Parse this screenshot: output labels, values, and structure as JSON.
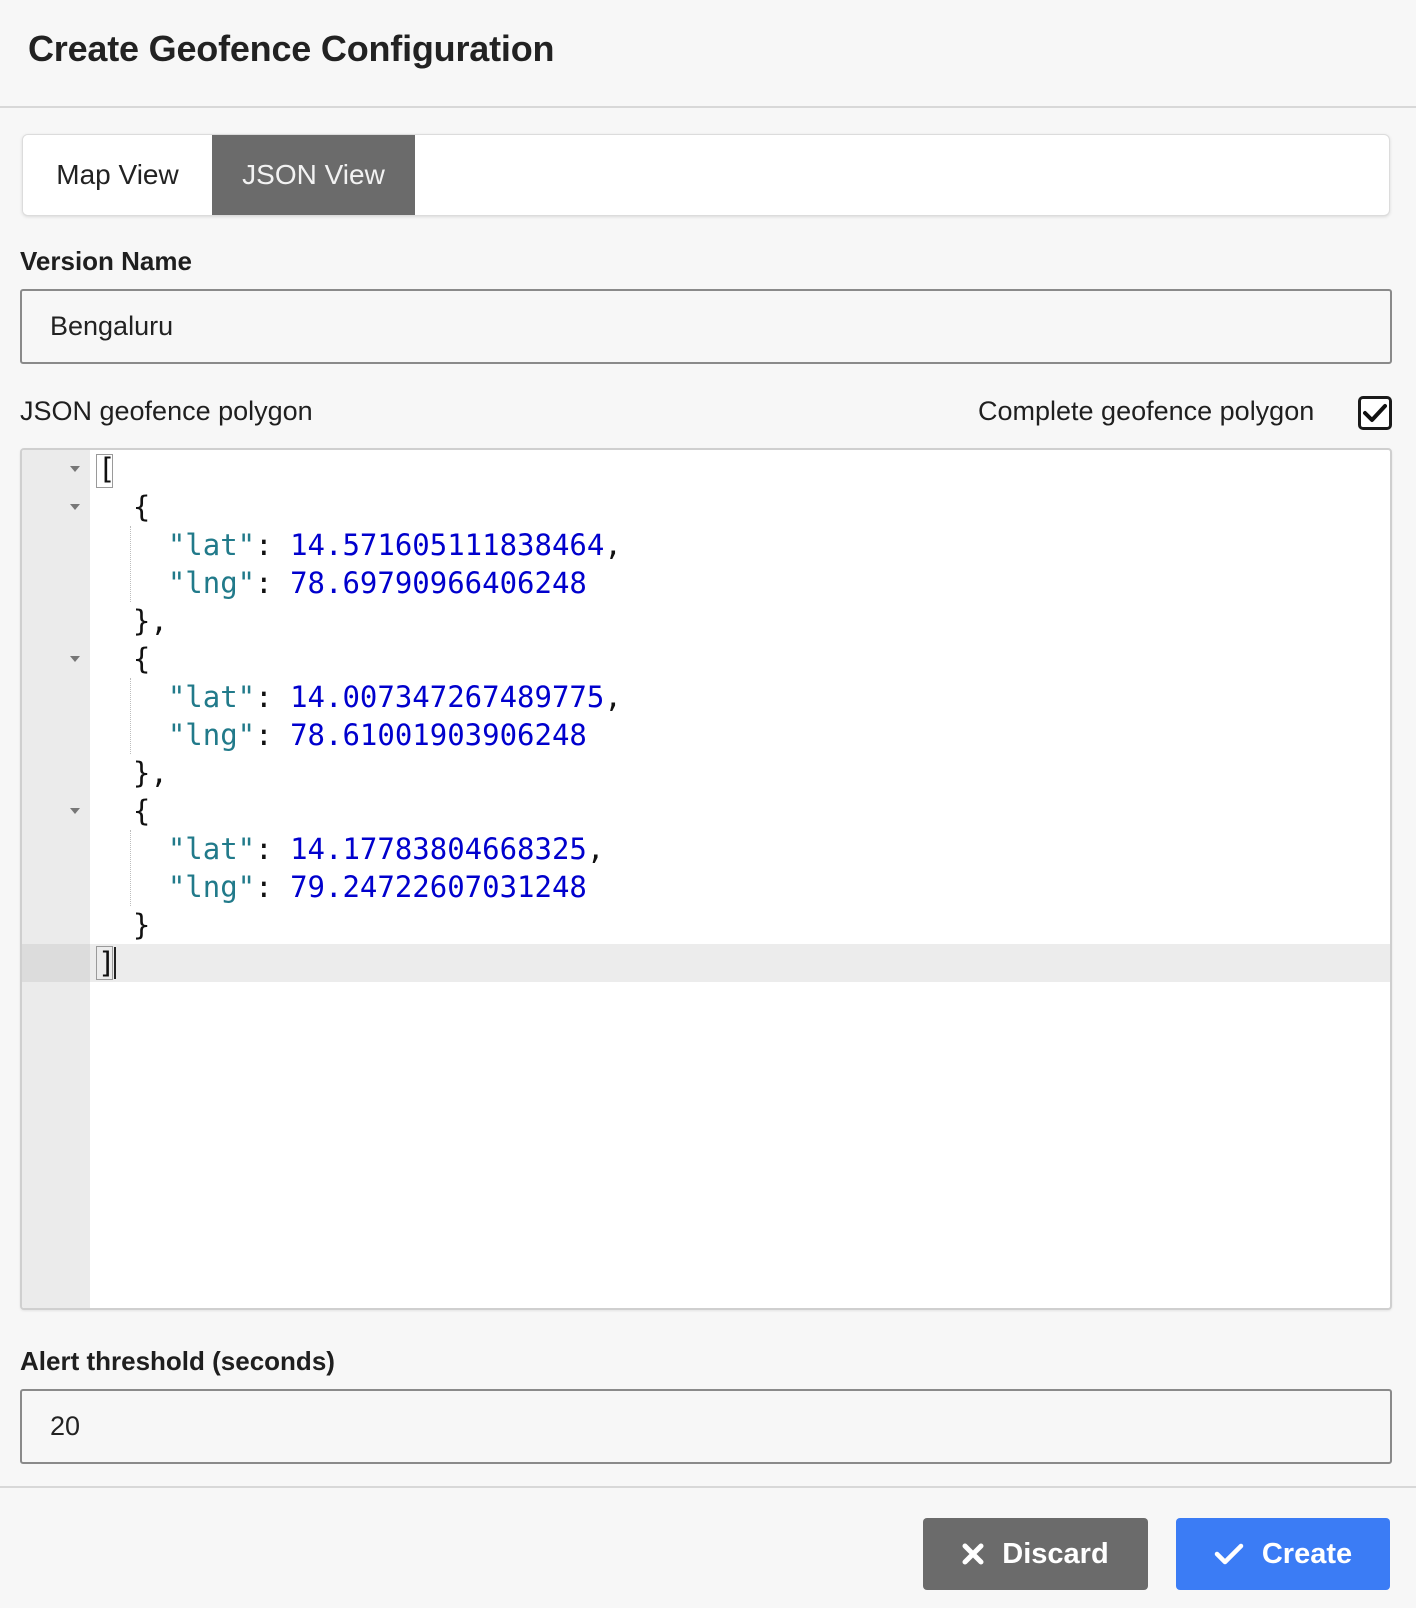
{
  "header": {
    "title": "Create Geofence Configuration"
  },
  "tabs": [
    {
      "label": "Map View",
      "active": false
    },
    {
      "label": "JSON View",
      "active": true
    }
  ],
  "version_name": {
    "label": "Version Name",
    "value": "Bengaluru"
  },
  "polygon": {
    "label": "JSON geofence polygon",
    "complete_label": "Complete geofence polygon",
    "complete_checked": true,
    "points": [
      {
        "lat": "14.571605111838464",
        "lng": "78.69790966406248"
      },
      {
        "lat": "14.007347267489775",
        "lng": "78.61001903906248"
      },
      {
        "lat": "14.17783804668325",
        "lng": "79.24722607031248"
      }
    ]
  },
  "alert": {
    "label": "Alert threshold (seconds)",
    "value": "20"
  },
  "footer": {
    "discard_label": "Discard",
    "create_label": "Create"
  },
  "colors": {
    "tab_active_bg": "#6b6b6b",
    "discard_bg": "#6b6b6b",
    "create_bg": "#3b7cf5",
    "json_key": "#217a8a",
    "json_number": "#0000cd"
  }
}
